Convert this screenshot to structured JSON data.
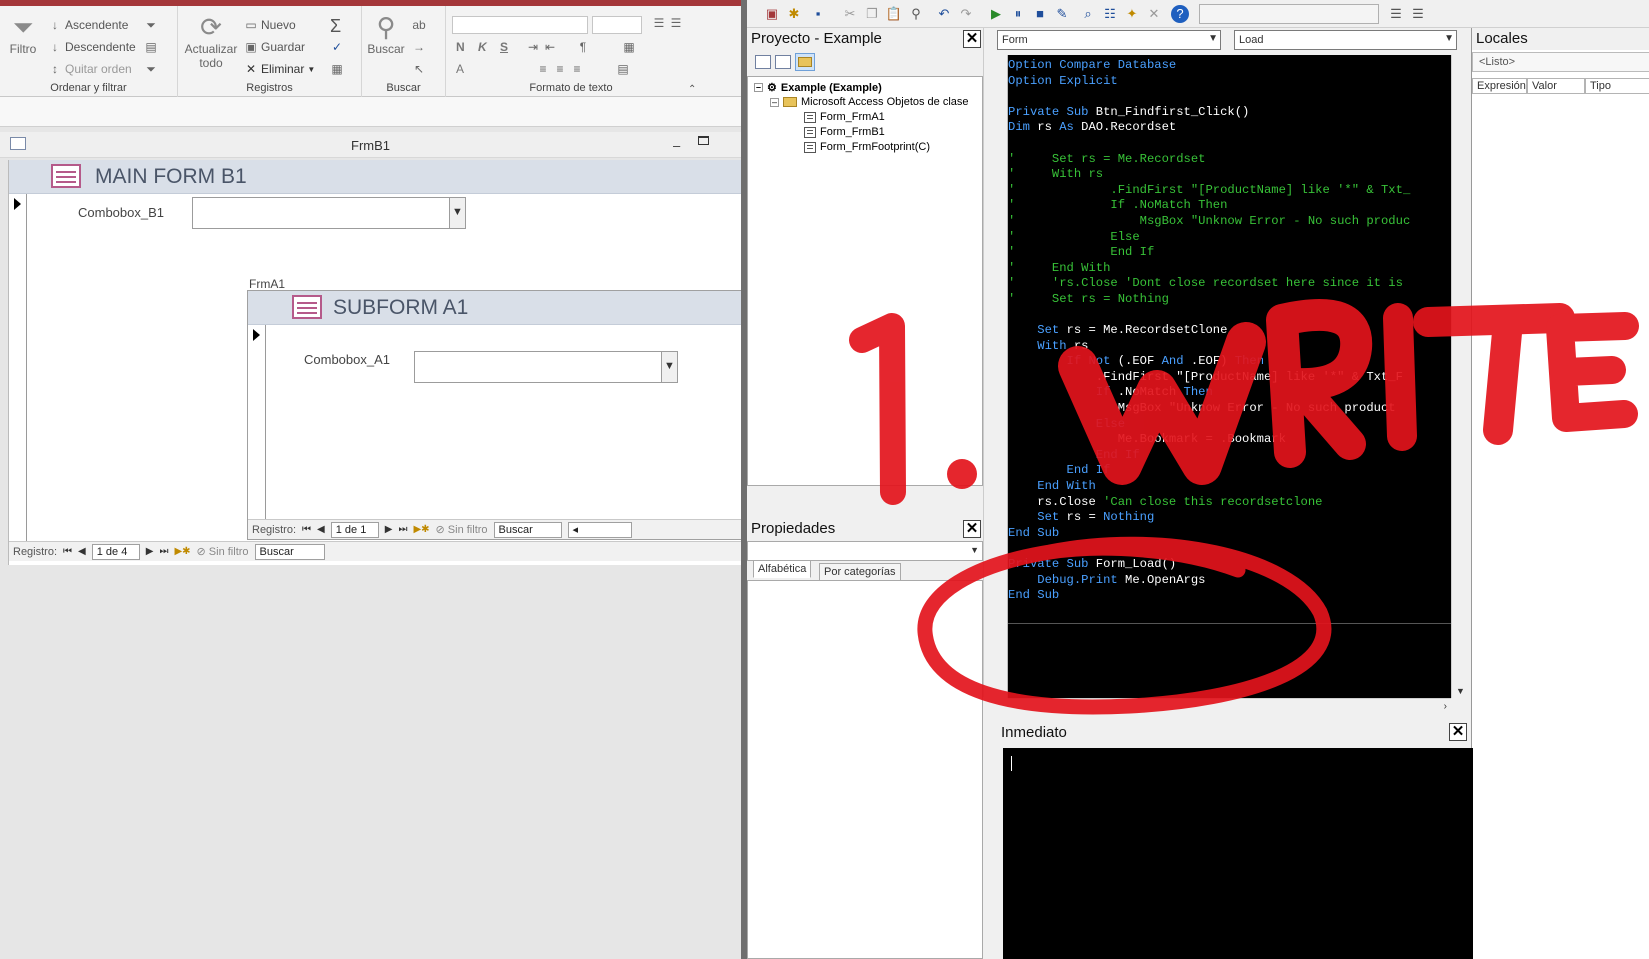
{
  "access": {
    "ribbon": {
      "sort_filter": {
        "filter_label": "Filtro",
        "ascending_label": "Ascendente",
        "descending_label": "Descendente",
        "remove_sort_label": "Quitar orden",
        "group_label": "Ordenar y filtrar"
      },
      "records": {
        "refresh_label": "Actualizar todo",
        "new_label": "Nuevo",
        "save_label": "Guardar",
        "delete_label": "Eliminar",
        "group_label": "Registros"
      },
      "find": {
        "find_label": "Buscar",
        "group_label": "Buscar"
      },
      "text_format": {
        "bold": "N",
        "italic": "K",
        "underline": "S",
        "font_color": "A",
        "group_label": "Formato de texto"
      }
    },
    "form_window_title": "FrmB1",
    "main_form": {
      "header": "MAIN FORM B1",
      "combo_label": "Combobox_B1",
      "nav": {
        "label": "Registro:",
        "position": "1 de 4",
        "filter": "Sin filtro",
        "search": "Buscar"
      }
    },
    "subform": {
      "control_label": "FrmA1",
      "header": "SUBFORM A1",
      "combo_label": "Combobox_A1",
      "nav": {
        "label": "Registro:",
        "position": "1 de 1",
        "filter": "Sin filtro",
        "search": "Buscar"
      }
    }
  },
  "vbe": {
    "project_pane": {
      "title": "Proyecto - Example",
      "root": "Example (Example)",
      "folder": "Microsoft Access Objetos de clase",
      "items": [
        "Form_FrmA1",
        "Form_FrmB1",
        "Form_FrmFootprint(C)"
      ]
    },
    "properties_pane": {
      "title": "Propiedades",
      "tab_alpha": "Alfabética",
      "tab_category": "Por categorías"
    },
    "code_window": {
      "object_combo": "Form",
      "procedure_combo": "Load"
    },
    "immediate": {
      "title": "Inmediato"
    },
    "locals": {
      "title": "Locales",
      "status": "<Listo>",
      "columns": [
        "Expresión",
        "Valor",
        "Tipo"
      ]
    },
    "code_lines": [
      [
        {
          "t": "Option Compare Database",
          "c": "kw"
        }
      ],
      [
        {
          "t": "Option Explicit",
          "c": "kw"
        }
      ],
      [
        {
          "t": "",
          "c": "tx"
        }
      ],
      [
        {
          "t": "Private Sub ",
          "c": "kw"
        },
        {
          "t": "Btn_Findfirst_Click()",
          "c": "tx"
        }
      ],
      [
        {
          "t": "Dim ",
          "c": "kw"
        },
        {
          "t": "rs ",
          "c": "tx"
        },
        {
          "t": "As ",
          "c": "kw"
        },
        {
          "t": "DAO.Recordset",
          "c": "tx"
        }
      ],
      [
        {
          "t": "",
          "c": "tx"
        }
      ],
      [
        {
          "t": "'     Set rs = Me.Recordset",
          "c": "cm"
        }
      ],
      [
        {
          "t": "'     With rs",
          "c": "cm"
        }
      ],
      [
        {
          "t": "'             .FindFirst \"[ProductName] like '*\" & Txt_",
          "c": "cm"
        }
      ],
      [
        {
          "t": "'             If .NoMatch Then",
          "c": "cm"
        }
      ],
      [
        {
          "t": "'                 MsgBox \"Unknow Error - No such produc",
          "c": "cm"
        }
      ],
      [
        {
          "t": "'             Else",
          "c": "cm"
        }
      ],
      [
        {
          "t": "'             End If",
          "c": "cm"
        }
      ],
      [
        {
          "t": "'     End With",
          "c": "cm"
        }
      ],
      [
        {
          "t": "'     'rs.Close 'Dont close recordset here since it is",
          "c": "cm"
        }
      ],
      [
        {
          "t": "'     Set rs = Nothing",
          "c": "cm"
        }
      ],
      [
        {
          "t": "",
          "c": "tx"
        }
      ],
      [
        {
          "t": "    Set ",
          "c": "kw"
        },
        {
          "t": "rs = Me.RecordsetClone",
          "c": "tx"
        }
      ],
      [
        {
          "t": "    With ",
          "c": "kw"
        },
        {
          "t": "rs",
          "c": "tx"
        }
      ],
      [
        {
          "t": "        If Not ",
          "c": "kw"
        },
        {
          "t": "(.EOF ",
          "c": "tx"
        },
        {
          "t": "And ",
          "c": "kw"
        },
        {
          "t": ".EOF) ",
          "c": "tx"
        },
        {
          "t": "Then",
          "c": "kw"
        }
      ],
      [
        {
          "t": "            .FindFirst \"[ProductName] like '*\" & Txt_F",
          "c": "tx"
        }
      ],
      [
        {
          "t": "            If ",
          "c": "kw"
        },
        {
          "t": ".NoMatch ",
          "c": "tx"
        },
        {
          "t": "Then",
          "c": "kw"
        }
      ],
      [
        {
          "t": "               MsgBox \"Unknow Error - No such product",
          "c": "tx"
        }
      ],
      [
        {
          "t": "            Else",
          "c": "kw"
        }
      ],
      [
        {
          "t": "               Me.Bookmark = .Bookmark",
          "c": "tx"
        }
      ],
      [
        {
          "t": "            End If",
          "c": "kw"
        }
      ],
      [
        {
          "t": "        End If",
          "c": "kw"
        }
      ],
      [
        {
          "t": "    End With",
          "c": "kw"
        }
      ],
      [
        {
          "t": "    rs.Close ",
          "c": "tx"
        },
        {
          "t": "'Can close this recordsetclone",
          "c": "cm"
        }
      ],
      [
        {
          "t": "    Set ",
          "c": "kw"
        },
        {
          "t": "rs = ",
          "c": "tx"
        },
        {
          "t": "Nothing",
          "c": "kw"
        }
      ],
      [
        {
          "t": "End Sub",
          "c": "kw"
        }
      ],
      [
        {
          "t": "",
          "c": "tx"
        }
      ],
      [
        {
          "t": "Private Sub ",
          "c": "kw"
        },
        {
          "t": "Form_Load()",
          "c": "tx"
        }
      ],
      [
        {
          "t": "    Debug.Print ",
          "c": "kw"
        },
        {
          "t": "Me.OpenArgs",
          "c": "tx"
        }
      ],
      [
        {
          "t": "End Sub",
          "c": "kw"
        }
      ]
    ]
  },
  "annotation": {
    "text": "1.WRITE",
    "color": "#e3141c"
  }
}
